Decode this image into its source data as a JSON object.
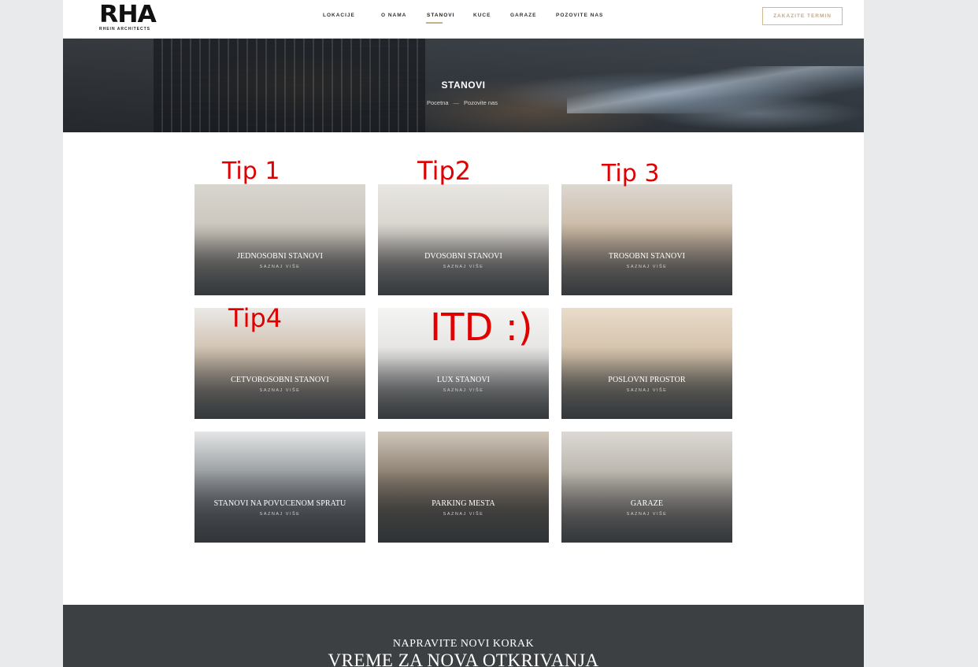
{
  "header": {
    "logo_mark": "RHA",
    "logo_sub": "RHEIN ARCHITECTS",
    "nav": [
      {
        "label": "LOKACIJE"
      },
      {
        "label": "O NAMA"
      },
      {
        "label": "STANOVI",
        "active": true
      },
      {
        "label": "KUCE"
      },
      {
        "label": "GARAZE"
      },
      {
        "label": "POZOVITE NAS"
      }
    ],
    "cta": "ZAKAZITE TERMIN"
  },
  "hero": {
    "title": "STANOVI",
    "breadcrumb": [
      "Pocetna",
      "Pozovite nas"
    ]
  },
  "annotations": {
    "tip1": "Tip 1",
    "tip2": "Tip2",
    "tip3": "Tip 3",
    "tip4": "Tip4",
    "itd": "ITD :)"
  },
  "cards": [
    {
      "title": "JEDNOSOBNI STANOVI",
      "more": "SAZNAJ VIŠE"
    },
    {
      "title": "DVOSOBNI STANOVI",
      "more": "SAZNAJ VIŠE"
    },
    {
      "title": "TROSOBNI STANOVI",
      "more": "SAZNAJ VIŠE"
    },
    {
      "title": "CETVOROSOBNI STANOVI",
      "more": "SAZNAJ VIŠE"
    },
    {
      "title": "LUX STANOVI",
      "more": "SAZNAJ VIŠE"
    },
    {
      "title": "POSLOVNI PROSTOR",
      "more": "SAZNAJ VIŠE"
    },
    {
      "title": "STANOVI NA POVUCENOM SPRATU",
      "more": "SAZNAJ VIŠE"
    },
    {
      "title": "PARKING MESTA",
      "more": "SAZNAJ VIŠE"
    },
    {
      "title": "GARAZE",
      "more": "SAZNAJ VIŠE"
    }
  ],
  "band": {
    "subtitle": "NAPRAVITE NOVI KORAK",
    "title": "VREME ZA NOVA OTKRIVANJA"
  },
  "colors": {
    "accent": "#c8b08a",
    "band": "#3d4042",
    "annotation": "#e00000"
  }
}
